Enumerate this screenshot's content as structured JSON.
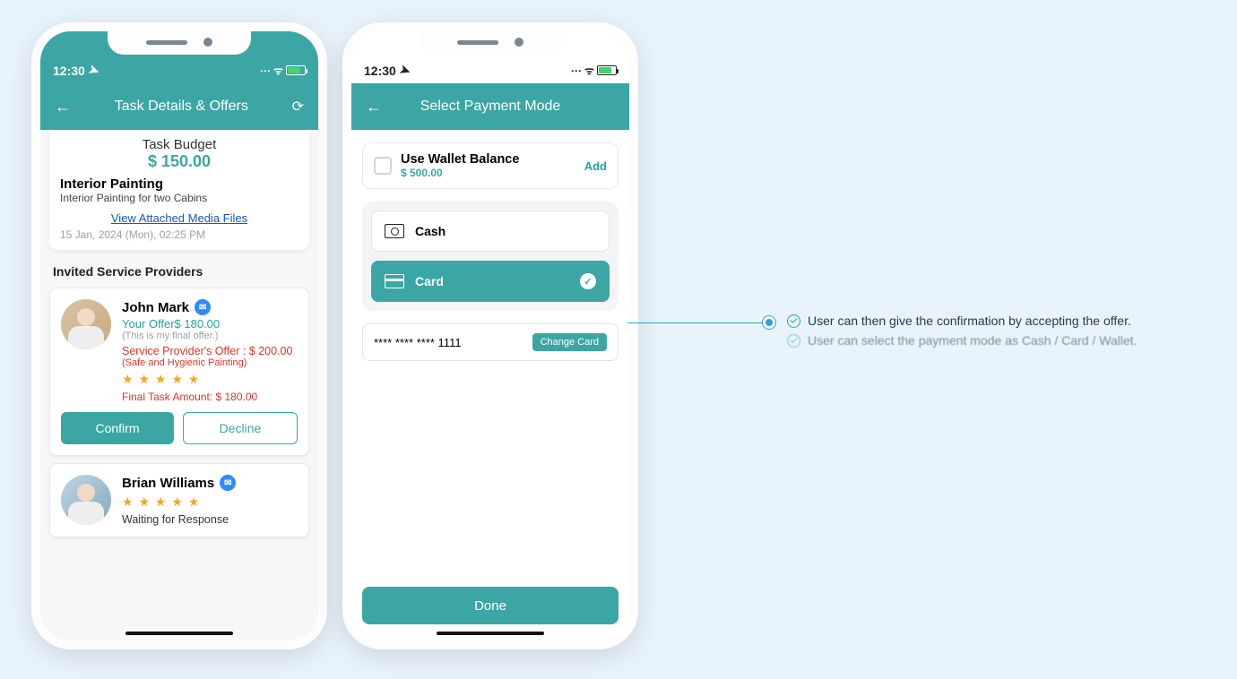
{
  "status_time": "12:30",
  "screen1": {
    "nav_title": "Task Details & Offers",
    "budget_label": "Task Budget",
    "budget_amount": "$ 150.00",
    "task_title": "Interior Painting",
    "task_desc": "Interior Painting for two Cabins",
    "media_link": "View Attached Media Files",
    "timestamp": "15 Jan, 2024 (Mon),  02:25 PM",
    "section_title": "Invited Service Providers",
    "prov1": {
      "name": "John Mark",
      "your_offer": "Your Offer$ 180.00",
      "your_note": "(This is my final offer.)",
      "sp_offer": "Service Provider's Offer : $ 200.00",
      "sp_note": "(Safe and Hygienic Painting)",
      "final": "Final Task Amount: $ 180.00",
      "confirm": "Confirm",
      "decline": "Decline"
    },
    "prov2": {
      "name": "Brian Williams",
      "status": "Waiting for Response"
    }
  },
  "screen2": {
    "nav_title": "Select Payment Mode",
    "wallet_title": "Use Wallet Balance",
    "wallet_balance": "$ 500.00",
    "add": "Add",
    "cash": "Cash",
    "card": "Card",
    "masked_card": "**** **** **** 1111",
    "change_card": "Change Card",
    "done": "Done"
  },
  "annotations": {
    "a1": "User can then give the confirmation by accepting the offer.",
    "a2": "User can select the payment mode as Cash / Card / Wallet."
  }
}
